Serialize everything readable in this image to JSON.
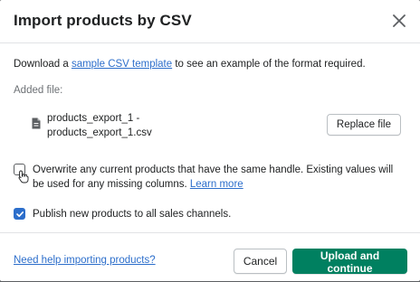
{
  "modal": {
    "title": "Import products by CSV",
    "close_icon": "close-icon"
  },
  "body": {
    "desc_prefix": "Download a ",
    "desc_link": "sample CSV template",
    "desc_suffix": " to see an example of the format required.",
    "added_file_label": "Added file:",
    "file": {
      "icon": "document-icon",
      "name": "products_export_1 - products_export_1.csv"
    },
    "replace_button": "Replace file",
    "overwrite": {
      "checked": false,
      "text": "Overwrite any current products that have the same handle. Existing values will be used for any missing columns. ",
      "link": "Learn more"
    },
    "publish": {
      "checked": true,
      "text": "Publish new products to all sales channels."
    }
  },
  "footer": {
    "help_link": "Need help importing products?",
    "cancel_button": "Cancel",
    "upload_button": "Upload and continue"
  },
  "colors": {
    "primary": "#008060",
    "link": "#2c6ecb",
    "checkbox_checked": "#2c6ecb"
  }
}
